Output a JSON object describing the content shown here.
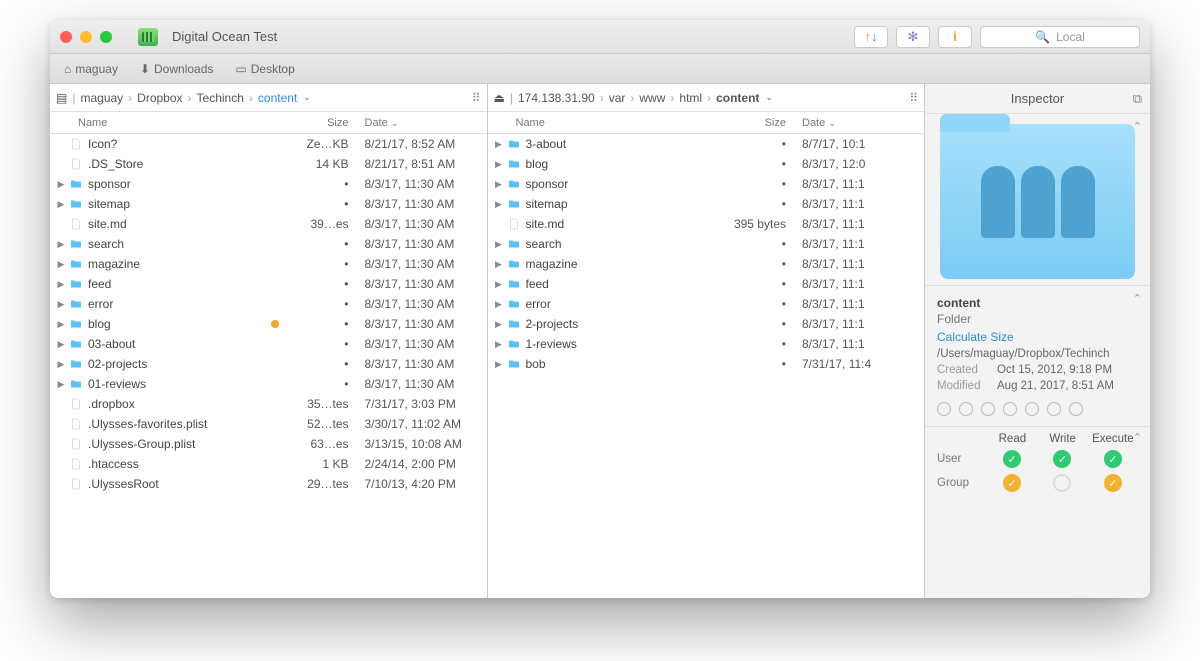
{
  "window": {
    "title": "Digital Ocean Test"
  },
  "toolbar_right": {
    "search_placeholder": "Local"
  },
  "toolbar2": {
    "fav1": "maguay",
    "fav2": "Downloads",
    "fav3": "Desktop"
  },
  "inspector_header": "Inspector",
  "left_pane": {
    "crumbs": [
      "maguay",
      "Dropbox",
      "Techinch",
      "content"
    ],
    "active_crumb": "content",
    "cols": {
      "name": "Name",
      "size": "Size",
      "date": "Date"
    },
    "items": [
      {
        "type": "file",
        "name": "Icon?",
        "size": "Ze…KB",
        "date": "8/21/17, 8:52 AM"
      },
      {
        "type": "file",
        "name": ".DS_Store",
        "size": "14 KB",
        "date": "8/21/17, 8:51 AM"
      },
      {
        "type": "folder",
        "name": "sponsor",
        "size": "•",
        "date": "8/3/17, 11:30 AM"
      },
      {
        "type": "folder",
        "name": "sitemap",
        "size": "•",
        "date": "8/3/17, 11:30 AM"
      },
      {
        "type": "file",
        "name": "site.md",
        "size": "39…es",
        "date": "8/3/17, 11:30 AM"
      },
      {
        "type": "folder",
        "name": "search",
        "size": "•",
        "date": "8/3/17, 11:30 AM"
      },
      {
        "type": "folder",
        "name": "magazine",
        "size": "•",
        "date": "8/3/17, 11:30 AM"
      },
      {
        "type": "folder",
        "name": "feed",
        "size": "•",
        "date": "8/3/17, 11:30 AM"
      },
      {
        "type": "folder",
        "name": "error",
        "size": "•",
        "date": "8/3/17, 11:30 AM"
      },
      {
        "type": "folder",
        "name": "blog",
        "size": "•",
        "date": "8/3/17, 11:30 AM",
        "badge": true
      },
      {
        "type": "folder",
        "name": "03-about",
        "size": "•",
        "date": "8/3/17, 11:30 AM"
      },
      {
        "type": "folder",
        "name": "02-projects",
        "size": "•",
        "date": "8/3/17, 11:30 AM"
      },
      {
        "type": "folder",
        "name": "01-reviews",
        "size": "•",
        "date": "8/3/17, 11:30 AM"
      },
      {
        "type": "file",
        "name": ".dropbox",
        "size": "35…tes",
        "date": "7/31/17, 3:03 PM"
      },
      {
        "type": "file",
        "name": ".Ulysses-favorites.plist",
        "size": "52…tes",
        "date": "3/30/17, 11:02 AM"
      },
      {
        "type": "file",
        "name": ".Ulysses-Group.plist",
        "size": "63…es",
        "date": "3/13/15, 10:08 AM"
      },
      {
        "type": "file",
        "name": ".htaccess",
        "size": "1 KB",
        "date": "2/24/14, 2:00 PM"
      },
      {
        "type": "file",
        "name": ".UlyssesRoot",
        "size": "29…tes",
        "date": "7/10/13, 4:20 PM"
      }
    ]
  },
  "right_pane": {
    "crumbs": [
      "174.138.31.90",
      "var",
      "www",
      "html",
      "content"
    ],
    "active_crumb": "content",
    "cols": {
      "name": "Name",
      "size": "Size",
      "date": "Date"
    },
    "items": [
      {
        "type": "folder",
        "name": "3-about",
        "size": "•",
        "date": "8/7/17, 10:1"
      },
      {
        "type": "folder",
        "name": "blog",
        "size": "•",
        "date": "8/3/17, 12:0"
      },
      {
        "type": "folder",
        "name": "sponsor",
        "size": "•",
        "date": "8/3/17, 11:1"
      },
      {
        "type": "folder",
        "name": "sitemap",
        "size": "•",
        "date": "8/3/17, 11:1"
      },
      {
        "type": "file",
        "name": "site.md",
        "size": "395 bytes",
        "date": "8/3/17, 11:1"
      },
      {
        "type": "folder",
        "name": "search",
        "size": "•",
        "date": "8/3/17, 11:1"
      },
      {
        "type": "folder",
        "name": "magazine",
        "size": "•",
        "date": "8/3/17, 11:1"
      },
      {
        "type": "folder",
        "name": "feed",
        "size": "•",
        "date": "8/3/17, 11:1"
      },
      {
        "type": "folder",
        "name": "error",
        "size": "•",
        "date": "8/3/17, 11:1"
      },
      {
        "type": "folder",
        "name": "2-projects",
        "size": "•",
        "date": "8/3/17, 11:1"
      },
      {
        "type": "folder",
        "name": "1-reviews",
        "size": "•",
        "date": "8/3/17, 11:1"
      },
      {
        "type": "folder",
        "name": "bob",
        "size": "•",
        "date": "7/31/17, 11:4"
      }
    ]
  },
  "inspector": {
    "name": "content",
    "kind": "Folder",
    "calc": "Calculate Size",
    "path": "/Users/maguay/Dropbox/Techinch",
    "created_label": "Created",
    "created": "Oct 15, 2012, 9:18 PM",
    "modified_label": "Modified",
    "modified": "Aug 21, 2017, 8:51 AM",
    "perm_cols": [
      "Read",
      "Write",
      "Execute"
    ],
    "perm_rows": [
      {
        "label": "User",
        "vals": [
          "g",
          "g",
          "g"
        ]
      },
      {
        "label": "Group",
        "vals": [
          "o",
          "off",
          "o"
        ]
      }
    ]
  }
}
